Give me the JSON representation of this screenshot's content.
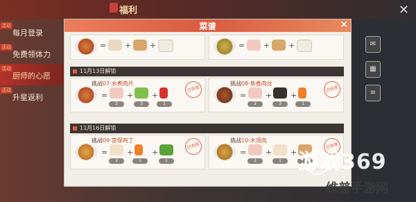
{
  "topbar": {
    "title": "福利"
  },
  "sidebar": {
    "items": [
      {
        "label": "每月登录",
        "badge": "活动",
        "active": false
      },
      {
        "label": "免费领体力",
        "badge": "活动",
        "active": false
      },
      {
        "label": "厨师的心愿",
        "badge": "活动",
        "active": true
      },
      {
        "label": "升星返利",
        "badge": "活动",
        "active": false
      }
    ]
  },
  "dialog": {
    "title": "菜谱",
    "sections": [
      {
        "label": "11月13日解锁"
      },
      {
        "label": "11月16日解锁"
      }
    ],
    "challenges": [
      {
        "prefix": "挑战",
        "num": "07",
        "name": "水煮肉片",
        "counts": [
          "2",
          "3",
          "1"
        ]
      },
      {
        "prefix": "挑战",
        "num": "08",
        "name": "鱼香肉丝",
        "counts": [
          "2",
          "3",
          "1"
        ]
      },
      {
        "prefix": "挑战",
        "num": "09",
        "name": "宫保鸡丁",
        "counts": [
          "2",
          "1",
          "1"
        ]
      },
      {
        "prefix": "挑战",
        "num": "10",
        "name": "木须肉",
        "counts": [
          "2",
          "1",
          "1"
        ]
      }
    ],
    "stamp": "已完成"
  },
  "watermark": {
    "main": "游戏369",
    "sub": "维普手游网"
  },
  "colors": {
    "accent": "#d85b3f",
    "section_bg": "#3b3633",
    "card_bg": "#fbf8f3"
  }
}
